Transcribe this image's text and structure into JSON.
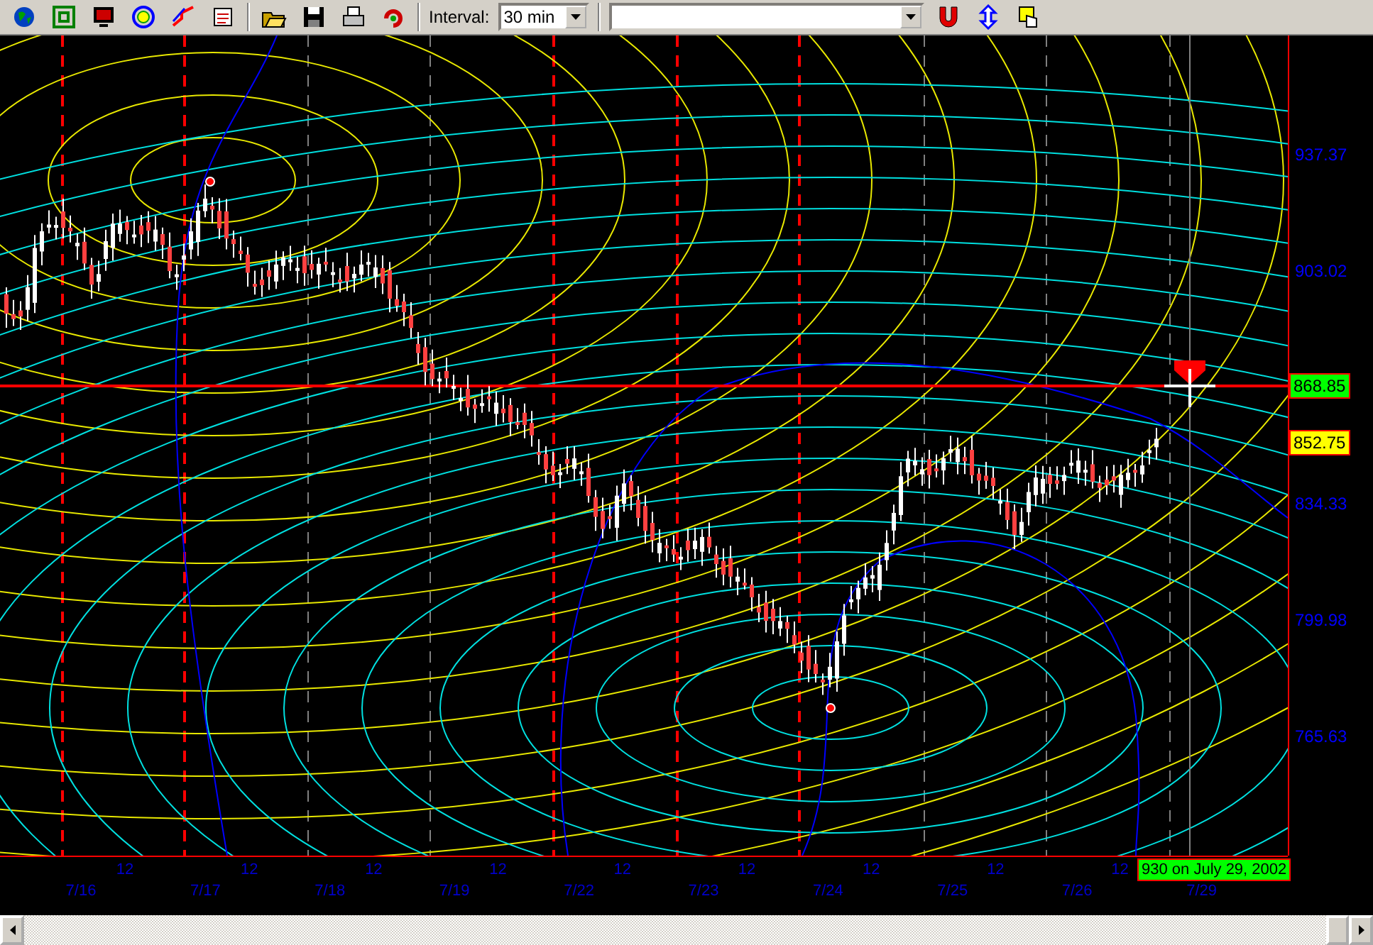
{
  "toolbar": {
    "interval_label": "Interval:",
    "interval_value": "30 min"
  },
  "chart": {
    "price_labels": [
      {
        "text": "937.37",
        "kind": "tick"
      },
      {
        "text": "903.02",
        "kind": "tick"
      },
      {
        "text": "868.85",
        "kind": "current"
      },
      {
        "text": "852.75",
        "kind": "last"
      },
      {
        "text": "834.33",
        "kind": "tick"
      },
      {
        "text": "799.98",
        "kind": "tick"
      },
      {
        "text": "765.63",
        "kind": "tick"
      }
    ],
    "midday_labels": [
      "12",
      "12",
      "12",
      "12",
      "12",
      "12",
      "12",
      "12",
      "12"
    ],
    "date_labels": [
      "7/16",
      "7/17",
      "7/18",
      "7/19",
      "7/22",
      "7/23",
      "7/24",
      "7/25",
      "7/26",
      "7/29"
    ],
    "cursor_label": "930 on July 29, 2002"
  }
}
